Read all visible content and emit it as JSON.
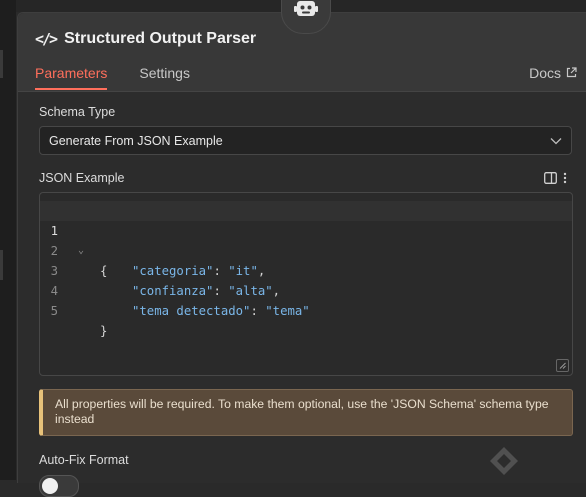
{
  "panel": {
    "title": "Structured Output Parser",
    "tabs": [
      {
        "label": "Parameters",
        "active": true
      },
      {
        "label": "Settings",
        "active": false
      }
    ],
    "docs_label": "Docs"
  },
  "schema_type": {
    "label": "Schema Type",
    "value": "Generate From JSON Example"
  },
  "json_example": {
    "label": "JSON Example",
    "lines": [
      {
        "num": "1",
        "text": "{"
      },
      {
        "num": "2",
        "key": "\"categoria\"",
        "sep": ": ",
        "val": "\"it\"",
        "tail": ","
      },
      {
        "num": "3",
        "key": "\"confianza\"",
        "sep": ": ",
        "val": "\"alta\"",
        "tail": ","
      },
      {
        "num": "4",
        "key": "\"tema detectado\"",
        "sep": ": ",
        "val": "\"tema\"",
        "tail": ""
      },
      {
        "num": "5",
        "text": "}"
      }
    ]
  },
  "notice": {
    "text": "All properties will be required. To make them optional, use the 'JSON Schema' schema type instead"
  },
  "auto_fix": {
    "label": "Auto-Fix Format",
    "enabled": false
  },
  "colors": {
    "accent": "#ff6f5c",
    "json_key": "#7ab6e8",
    "notice_bg": "#5a4a3a",
    "notice_border": "#e8c27a"
  },
  "icons": [
    "robot-icon",
    "code-icon",
    "external-link-icon",
    "chevron-down-icon",
    "panel-icon",
    "more-icon",
    "fold-icon",
    "resize-icon"
  ]
}
